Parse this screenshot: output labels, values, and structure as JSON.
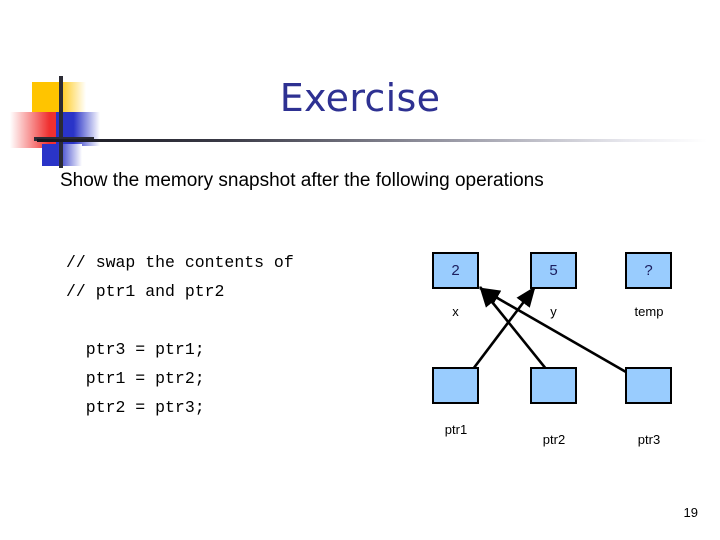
{
  "slide": {
    "title": "Exercise",
    "subtitle": "Show the memory snapshot after the following operations",
    "number": "19",
    "title_color": "#2e3192",
    "box_fill_color": "#99ccfe",
    "box_border_color": "#000000"
  },
  "code": {
    "lines": [
      "// swap the contents of",
      "// ptr1 and ptr2",
      "",
      "  ptr3 = ptr1;",
      "  ptr1 = ptr2;",
      "  ptr2 = ptr3;"
    ],
    "text": "// swap the contents of\n// ptr1 and ptr2\n\n  ptr3 = ptr1;\n  ptr1 = ptr2;\n  ptr2 = ptr3;"
  },
  "diagram": {
    "value_boxes": [
      {
        "value": "2",
        "label": "x"
      },
      {
        "value": "5",
        "label": "y"
      },
      {
        "value": "?",
        "label": "temp"
      }
    ],
    "pointer_boxes": [
      {
        "value": "",
        "label": "ptr1"
      },
      {
        "value": "",
        "label": "ptr2"
      },
      {
        "value": "",
        "label": "ptr3"
      }
    ],
    "arrows": [
      {
        "from": "ptr1",
        "to": "y"
      },
      {
        "from": "ptr2",
        "to": "x"
      },
      {
        "from": "ptr3",
        "to": "x"
      }
    ]
  }
}
